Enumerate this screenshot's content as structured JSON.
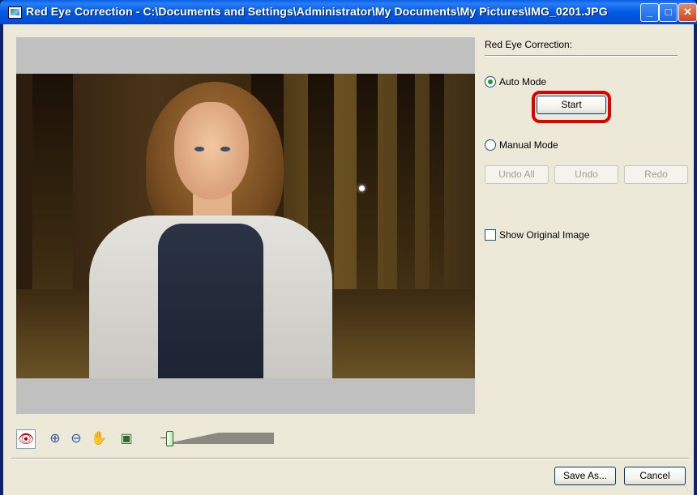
{
  "window": {
    "title": "Red Eye Correction - C:\\Documents and Settings\\Administrator\\My Documents\\My Pictures\\IMG_0201.JPG",
    "controls": {
      "minimize": "_",
      "maximize": "□",
      "close": "✕"
    }
  },
  "right_panel": {
    "section_label": "Red Eye Correction:",
    "auto_mode": {
      "label": "Auto Mode",
      "selected": true
    },
    "start_button": "Start",
    "manual_mode": {
      "label": "Manual Mode",
      "selected": false
    },
    "undo_all_button": "Undo All",
    "undo_button": "Undo",
    "redo_button": "Redo",
    "show_original": {
      "label": "Show Original Image",
      "checked": false
    }
  },
  "toolbar": {
    "tools": [
      {
        "name": "red-eye-tool",
        "icon": "eye-icon"
      },
      {
        "name": "zoom-in",
        "icon": "zoom-in-icon"
      },
      {
        "name": "zoom-out",
        "icon": "zoom-out-icon"
      },
      {
        "name": "pan",
        "icon": "hand-icon"
      },
      {
        "name": "fit",
        "icon": "fit-to-window-icon"
      }
    ],
    "zoom_level_fraction": 0.05
  },
  "footer": {
    "save_as_button": "Save As...",
    "cancel_button": "Cancel"
  },
  "colors": {
    "titlebar": "#0058e0",
    "window_bg": "#ece9d8",
    "highlight": "#e00000",
    "radio_dot": "#21a121"
  }
}
